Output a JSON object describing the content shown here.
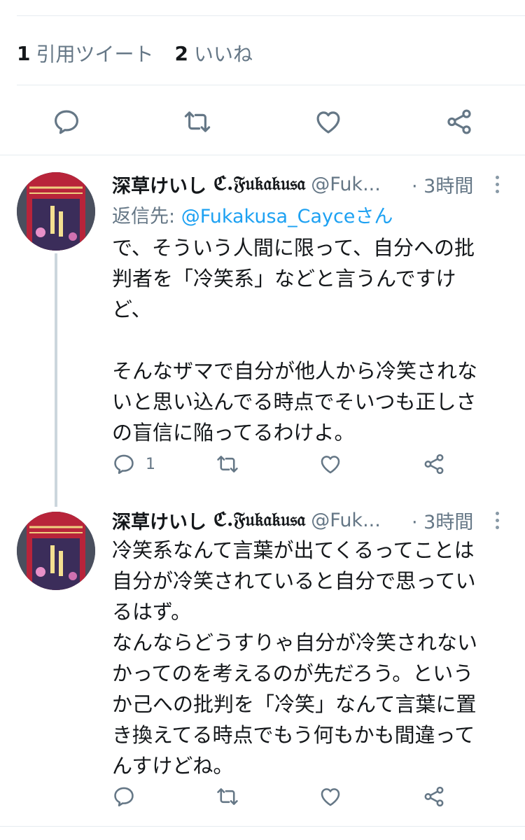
{
  "stats": [
    {
      "count": "1",
      "label": "引用ツイート"
    },
    {
      "count": "2",
      "label": "いいね"
    }
  ],
  "main_actions": [
    "reply-icon",
    "retweet-icon",
    "like-icon",
    "share-icon"
  ],
  "tweets": [
    {
      "name": "深草けいし",
      "name_deco": "ℭ.𝔉𝔲𝔨𝔞𝔨𝔲𝔰𝔞",
      "handle": "@Fuk...",
      "time": "· 3時間",
      "reply_prefix": "返信先: ",
      "reply_mention": "@Fukakusa_Cayceさん",
      "lines": [
        "で、そういう人間に限って、自分への批",
        "判者を「冷笑系」などと言うんですけ",
        "ど、",
        "",
        "そんなザマで自分が他人から冷笑されな",
        "いと思い込んでる時点でそいつも正しさ",
        "の盲信に陥ってるわけよ。"
      ],
      "reply_count": "1"
    },
    {
      "name": "深草けいし",
      "name_deco": "ℭ.𝔉𝔲𝔨𝔞𝔨𝔲𝔰𝔞",
      "handle": "@Fuk...",
      "time": "· 3時間",
      "lines": [
        "冷笑系なんて言葉が出てくるってことは",
        "自分が冷笑されていると自分で思ってい",
        "るはず。",
        "なんならどうすりゃ自分が冷笑されない",
        "かってのを考えるのが先だろう。という",
        "か己への批判を「冷笑」なんて言葉に置",
        "き換えてる時点でもう何もかも間違って",
        "んすけどね。"
      ],
      "reply_count": ""
    }
  ],
  "colors": {
    "accent": "#1da1f2",
    "muted": "#657786",
    "divider": "#e6ecf0"
  }
}
